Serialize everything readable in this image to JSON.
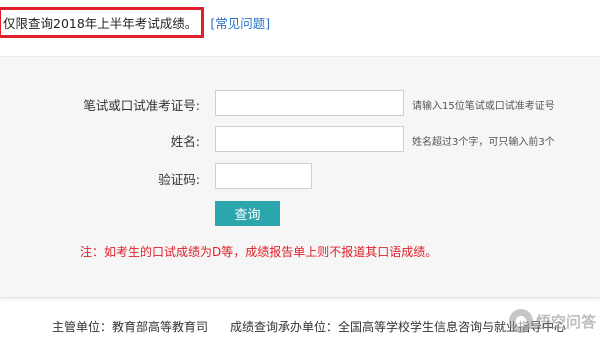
{
  "notice": {
    "text": "仅限查询2018年上半年考试成绩。",
    "highlight_color": "#e0202a"
  },
  "faq_link": {
    "open_bracket": "[",
    "label": "常见问题",
    "close_bracket": "]"
  },
  "form": {
    "exam_id": {
      "label": "笔试或口试准考证号:",
      "value": "",
      "hint": "请输入15位笔试或口试准考证号"
    },
    "name": {
      "label": "姓名:",
      "value": "",
      "hint": "姓名超过3个字，可只输入前3个"
    },
    "captcha": {
      "label": "验证码:",
      "value": ""
    },
    "submit_label": "查询",
    "button_color": "#2aa6ac",
    "warning": "注：如考生的口试成绩为D等，成绩报告单上则不报道其口语成绩。"
  },
  "footer": {
    "supervisor": "主管单位：教育部高等教育司",
    "service": "成绩查询承办单位：全国高等学校学生信息咨询与就业指导中心"
  },
  "watermark": {
    "icon": "chat-bubble-icon",
    "text": "悟空问答"
  }
}
